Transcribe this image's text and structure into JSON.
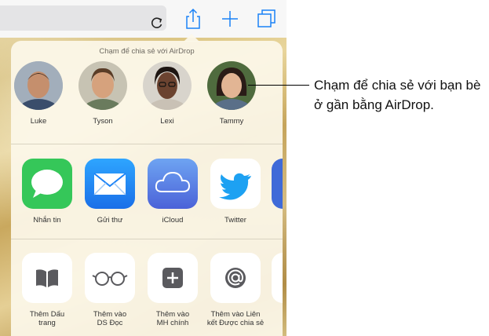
{
  "airdrop": {
    "title": "Chạm để chia sẻ với AirDrop",
    "people": [
      {
        "name": "Luke",
        "skin": "#c58f6d",
        "hair": "#3b2a20",
        "shirt": "#3a4d6b"
      },
      {
        "name": "Tyson",
        "skin": "#d6a27d",
        "hair": "#5a3d27",
        "shirt": "#6a7b5d"
      },
      {
        "name": "Lexi",
        "skin": "#6b4330",
        "hair": "#1e1612",
        "shirt": "#c9c1b5"
      },
      {
        "name": "Tammy",
        "skin": "#e2b594",
        "hair": "#2a1c17",
        "shirt": "#5a6f88"
      }
    ]
  },
  "apps": [
    {
      "label": "Nhắn tin",
      "icon": "messages-icon",
      "color": "#35c759"
    },
    {
      "label": "Gửi thư",
      "icon": "mail-icon",
      "color": "#1a82f7"
    },
    {
      "label": "iCloud",
      "icon": "icloud-icon",
      "color": "#5a7fe0"
    },
    {
      "label": "Twitter",
      "icon": "twitter-icon",
      "color": "#ffffff"
    }
  ],
  "actions": [
    {
      "label_line1": "Thêm Dấu",
      "label_line2": "trang",
      "icon": "bookmark-icon"
    },
    {
      "label_line1": "Thêm vào",
      "label_line2": "DS Đọc",
      "icon": "glasses-icon"
    },
    {
      "label_line1": "Thêm vào",
      "label_line2": "MH chính",
      "icon": "add-home-icon"
    },
    {
      "label_line1": "Thêm vào Liên",
      "label_line2": "kết Được chia sẻ",
      "icon": "shared-links-icon"
    }
  ],
  "callout": {
    "text": "Chạm để chia sẻ với bạn bè ở gần bằng AirDrop."
  },
  "colors": {
    "accent": "#1a82f7",
    "sheet": "#fcf8ea"
  }
}
